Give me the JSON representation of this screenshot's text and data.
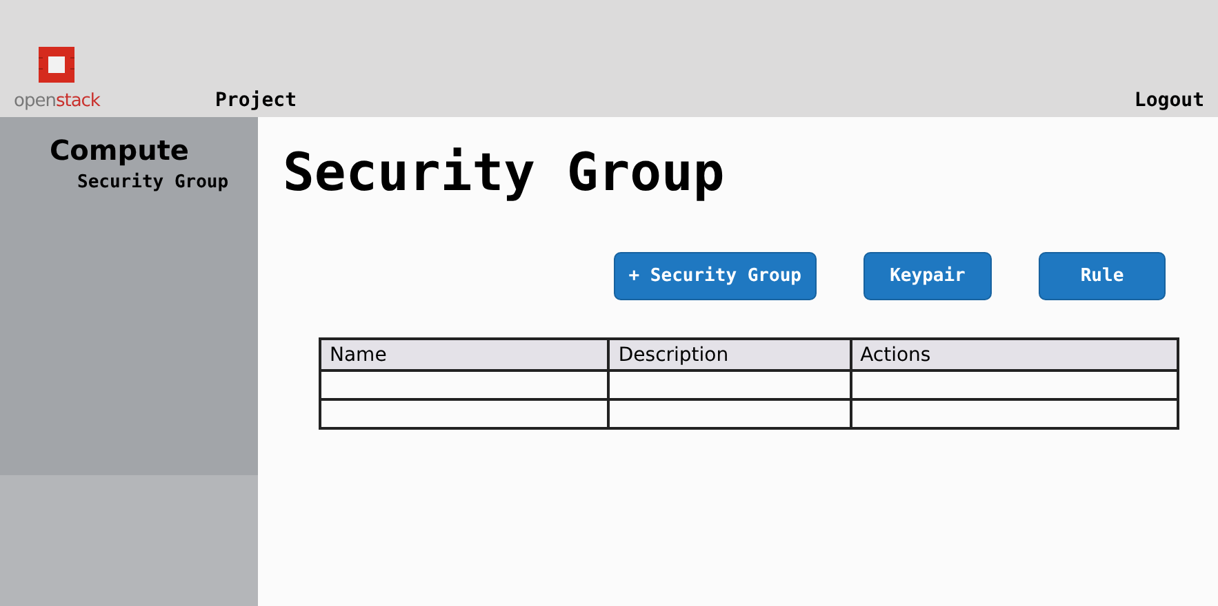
{
  "header": {
    "logo_text": [
      "open",
      "stack"
    ],
    "project": "Project",
    "logout": "Logout"
  },
  "sidebar": {
    "section": "Compute",
    "items": [
      {
        "label": "Security Group"
      }
    ]
  },
  "page_title": "Security Group",
  "buttons": [
    "+ Security Group",
    "Keypair",
    "Rule"
  ],
  "table": {
    "columns": [
      "Name",
      "Description",
      "Actions"
    ]
  }
}
